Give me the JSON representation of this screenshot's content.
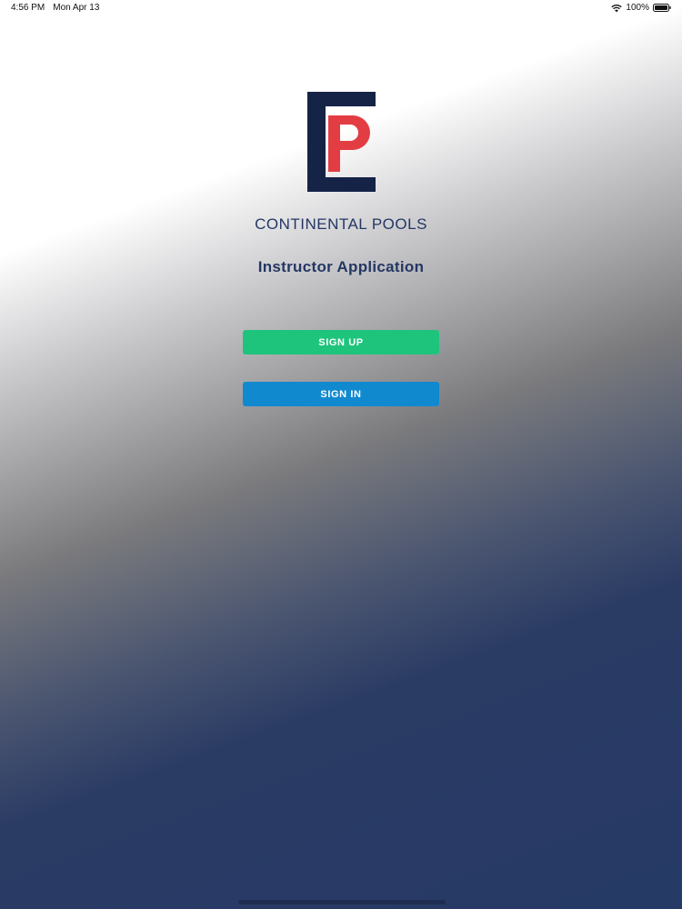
{
  "status_bar": {
    "time": "4:56 PM",
    "date": "Mon Apr 13",
    "battery": "100%"
  },
  "logo": {
    "icon": "continental-pools-logo",
    "colors": {
      "navy": "#152347",
      "red": "#e33d44"
    }
  },
  "brand": {
    "name": "CONTINENTAL POOLS",
    "subtitle": "Instructor Application"
  },
  "actions": {
    "sign_up_label": "SIGN UP",
    "sign_in_label": "SIGN IN"
  },
  "colors": {
    "text": "#243763",
    "sign_up": "#1fc47c",
    "sign_in": "#1089cf"
  }
}
